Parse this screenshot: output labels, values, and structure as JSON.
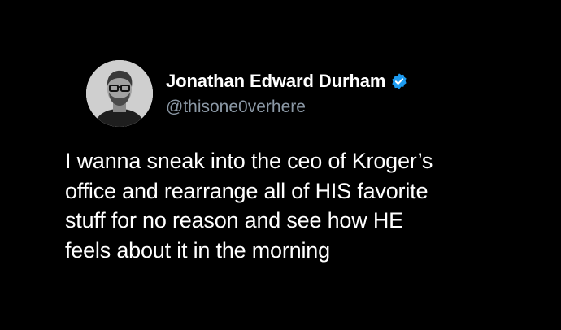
{
  "author": {
    "display_name": "Jonathan Edward Durham",
    "handle": "@thisone0verhere",
    "verified": true,
    "verified_color": "#1d9bf0"
  },
  "tweet": {
    "lines": [
      "I wanna sneak into the ceo of Kroger’s",
      "office and rearrange all of HIS favorite",
      "stuff for no reason and see how HE",
      "feels about it in the morning"
    ]
  },
  "colors": {
    "background": "#000000",
    "text": "#ffffff",
    "handle": "#8b98a5"
  },
  "icons": {
    "avatar": "profile-photo",
    "badge": "verified-badge-icon"
  }
}
